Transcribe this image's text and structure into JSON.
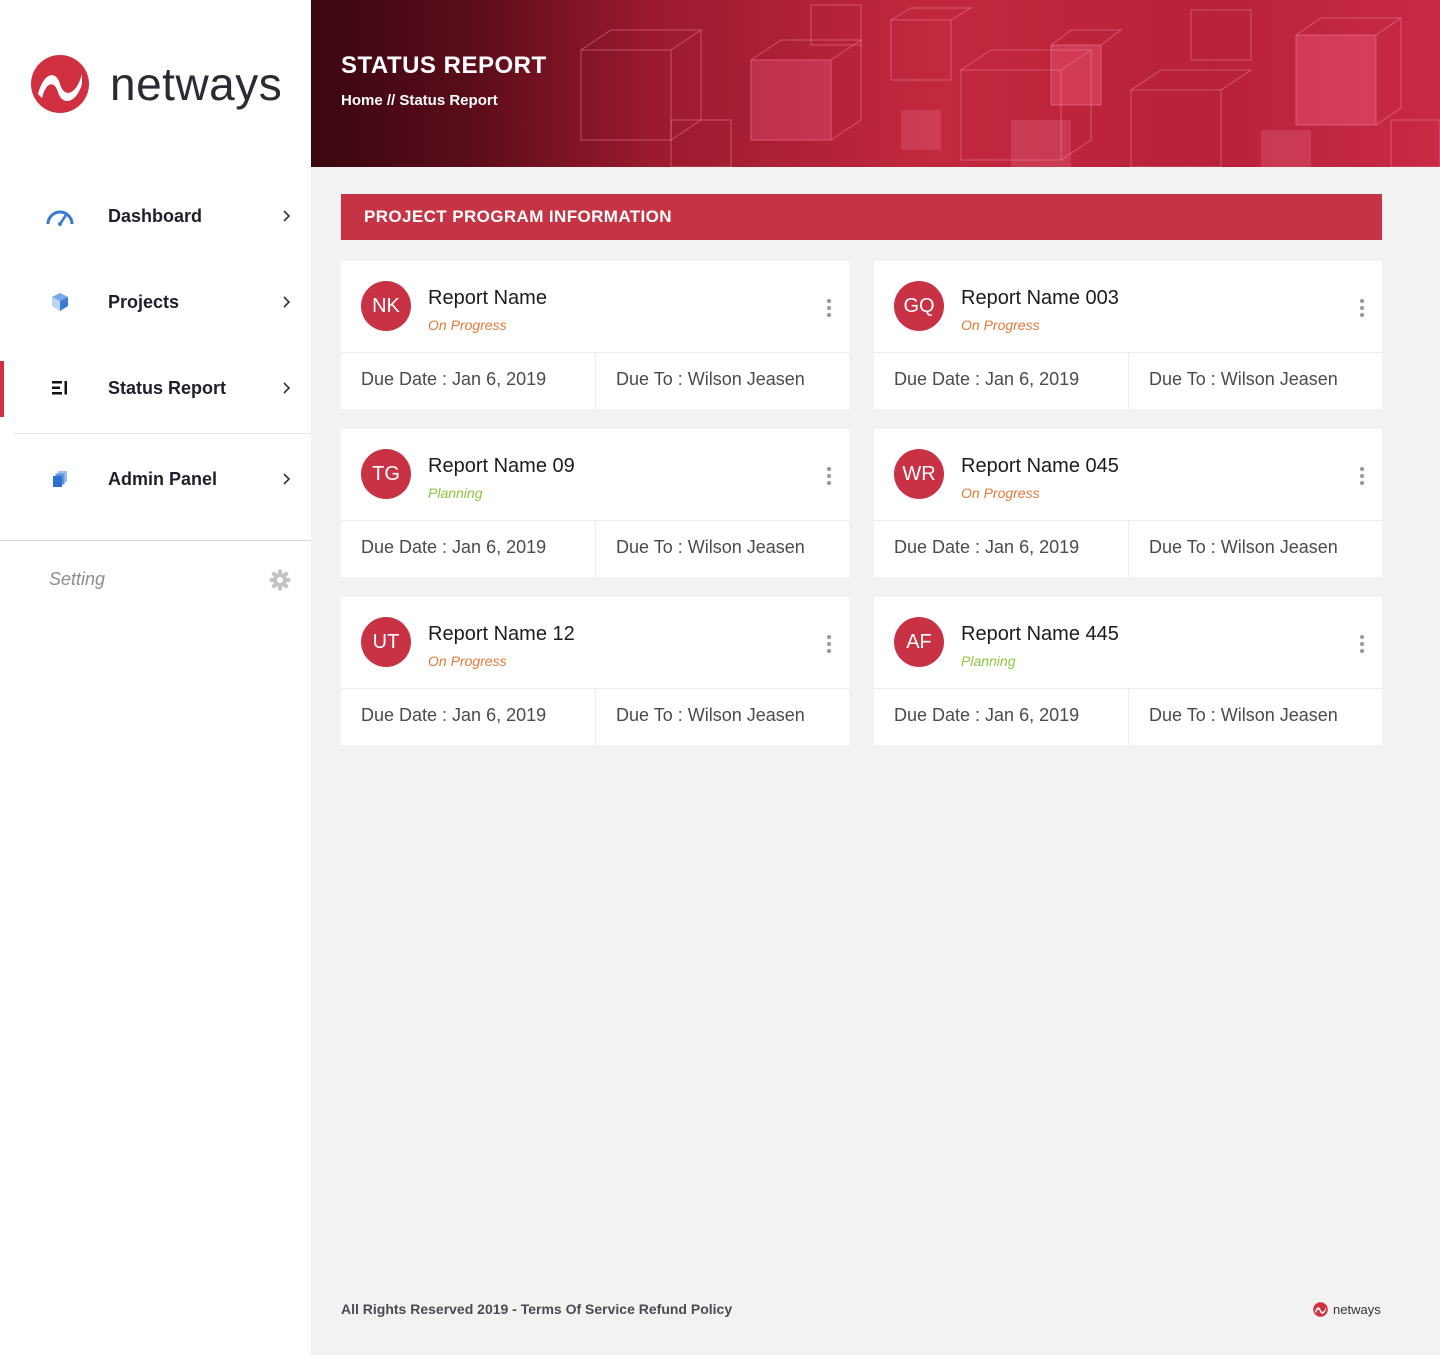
{
  "brand": {
    "name": "netways",
    "color": "#d0303f"
  },
  "sidebar": {
    "items": [
      {
        "label": "Dashboard",
        "icon": "dashboard-gauge-icon"
      },
      {
        "label": "Projects",
        "icon": "cube-icon"
      },
      {
        "label": "Status Report",
        "icon": "list-icon",
        "active": true
      },
      {
        "label": "Admin Panel",
        "icon": "stacked-pages-icon"
      }
    ],
    "setting": {
      "label": "Setting",
      "icon": "gear-icon"
    }
  },
  "header": {
    "title": "STATUS REPORT",
    "breadcrumb": "Home // Status Report"
  },
  "section": {
    "title": "PROJECT PROGRAM INFORMATION"
  },
  "status_colors": {
    "On Progress": "#e07a3a",
    "Planning": "#8dc63f"
  },
  "cards": [
    {
      "initials": "NK",
      "title": "Report Name",
      "status": "On Progress",
      "due_date": "Due Date : Jan 6, 2019",
      "due_to": "Due To : Wilson Jeasen"
    },
    {
      "initials": "GQ",
      "title": "Report Name 003",
      "status": "On Progress",
      "due_date": "Due Date : Jan 6, 2019",
      "due_to": "Due To : Wilson Jeasen"
    },
    {
      "initials": "TG",
      "title": "Report Name 09",
      "status": "Planning",
      "due_date": "Due Date : Jan 6, 2019",
      "due_to": "Due To : Wilson Jeasen"
    },
    {
      "initials": "WR",
      "title": "Report Name 045",
      "status": "On Progress",
      "due_date": "Due Date : Jan 6, 2019",
      "due_to": "Due To : Wilson Jeasen"
    },
    {
      "initials": "UT",
      "title": "Report Name 12",
      "status": "On Progress",
      "due_date": "Due Date : Jan 6, 2019",
      "due_to": "Due To : Wilson Jeasen"
    },
    {
      "initials": "AF",
      "title": "Report Name 445",
      "status": "Planning",
      "due_date": "Due Date : Jan 6, 2019",
      "due_to": "Due To : Wilson Jeasen"
    }
  ],
  "footer": {
    "text": "All Rights Reserved 2019 - Terms Of Service Refund Policy",
    "brand": "netways"
  }
}
